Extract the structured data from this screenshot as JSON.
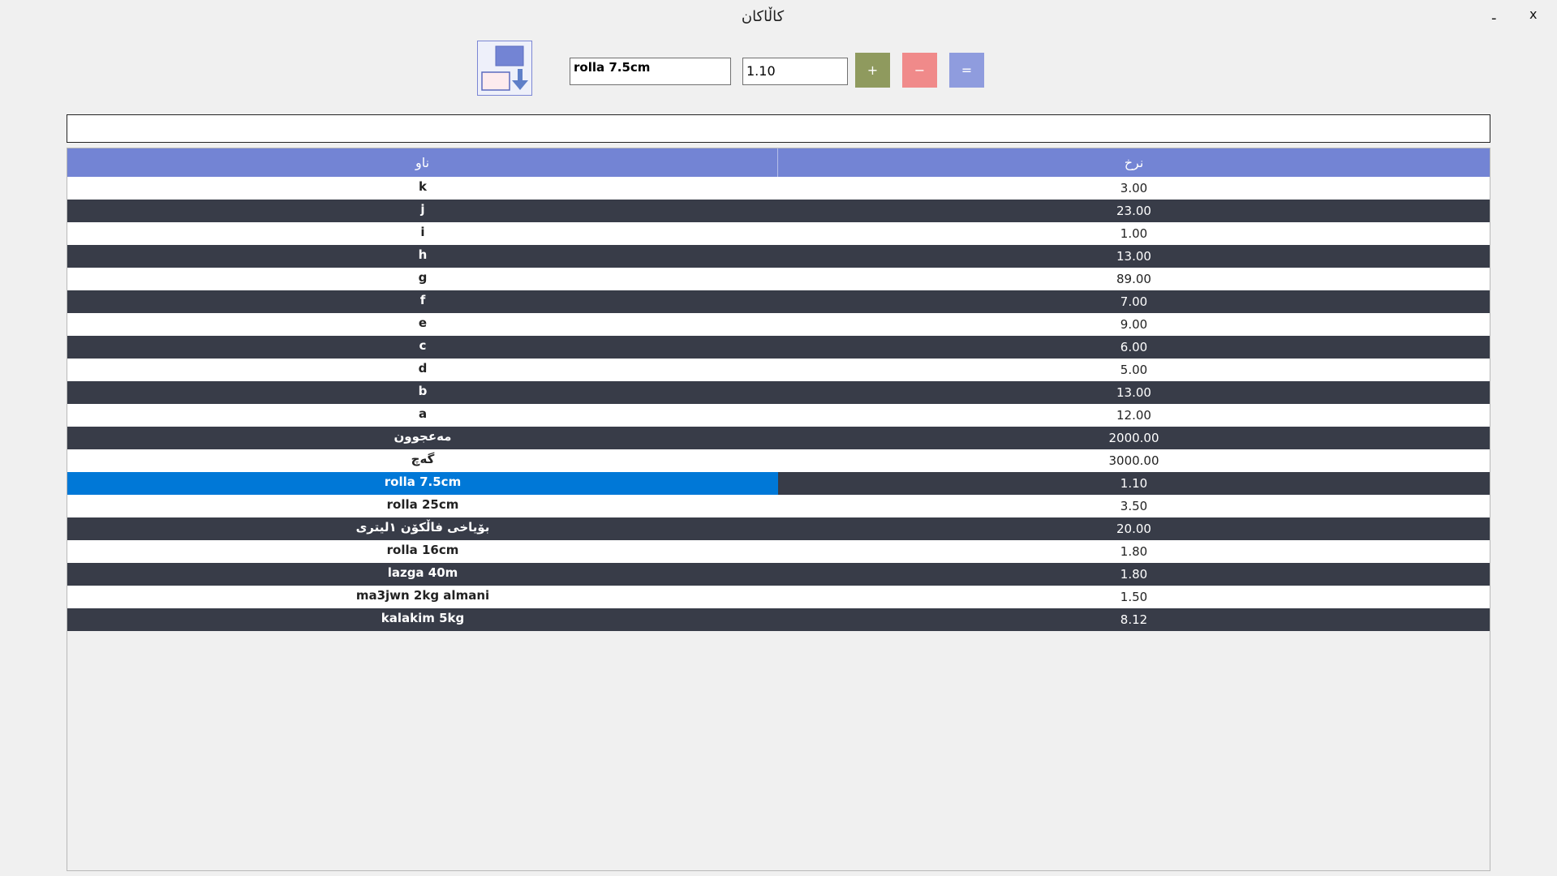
{
  "window": {
    "title": "کاڵاکان",
    "minimize_label": "-",
    "close_label": "x"
  },
  "toolbar": {
    "import_icon": "import-arrow-icon",
    "name_value": "rolla 7.5cm",
    "price_value": "1.10",
    "add_label": "+",
    "subtract_label": "−",
    "equals_label": "="
  },
  "search": {
    "value": ""
  },
  "colors": {
    "header": "#7384d4",
    "row_dark": "#383c48",
    "row_light": "#ffffff",
    "selection": "#0078d7",
    "add_button": "#8f9a5e",
    "subtract_button": "#f08a8a",
    "equals_button": "#8f9cde"
  },
  "table": {
    "columns": [
      "ناو",
      "نرخ"
    ],
    "rows": [
      {
        "name": "k",
        "price": "3.00"
      },
      {
        "name": "j",
        "price": "23.00"
      },
      {
        "name": "i",
        "price": "1.00"
      },
      {
        "name": "h",
        "price": "13.00"
      },
      {
        "name": "g",
        "price": "89.00"
      },
      {
        "name": "f",
        "price": "7.00"
      },
      {
        "name": "e",
        "price": "9.00"
      },
      {
        "name": "c",
        "price": "6.00"
      },
      {
        "name": "d",
        "price": "5.00"
      },
      {
        "name": "b",
        "price": "13.00"
      },
      {
        "name": "a",
        "price": "12.00"
      },
      {
        "name": "مەعجوون",
        "price": "2000.00"
      },
      {
        "name": "گەچ",
        "price": "3000.00"
      },
      {
        "name": "rolla 7.5cm",
        "price": "1.10",
        "selected": true
      },
      {
        "name": "rolla 25cm",
        "price": "3.50"
      },
      {
        "name": "بۆیاخی فاڵکۆن ١لیتری",
        "price": "20.00"
      },
      {
        "name": "rolla 16cm",
        "price": "1.80"
      },
      {
        "name": "lazga 40m",
        "price": "1.80"
      },
      {
        "name": "ma3jwn 2kg almani",
        "price": "1.50"
      },
      {
        "name": "kalakim 5kg",
        "price": "8.12"
      }
    ]
  }
}
